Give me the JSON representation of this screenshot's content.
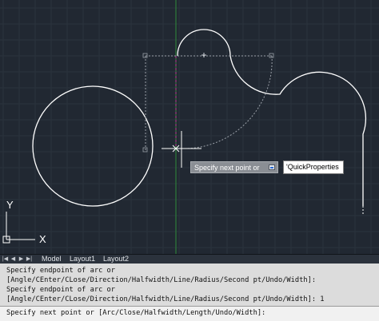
{
  "colors": {
    "background": "#212832",
    "grid": "#2b333d",
    "geometry": "#ffffff",
    "axis_x": "#b33c8e",
    "axis_y": "#2e8b3a",
    "tracking": "#9aa0a8"
  },
  "icons": {
    "ucs": "ucs-icon",
    "crosshair": "crosshair-cursor-icon",
    "dynamic_input": "dynamic-input-icon",
    "tab_first": "first-tab-icon",
    "tab_prev": "previous-tab-icon",
    "tab_next": "next-tab-icon",
    "tab_last": "last-tab-icon"
  },
  "ucs": {
    "x_label": "X",
    "y_label": "Y"
  },
  "tooltip": {
    "prompt": "Specify next point or",
    "input_value": "'QuickProperties"
  },
  "tabs": {
    "nav_first": "|◀",
    "nav_prev": "◀",
    "nav_next": "▶",
    "nav_last": "▶|",
    "model": "Model",
    "layout1": "Layout1",
    "layout2": "Layout2"
  },
  "command_line": {
    "history": [
      "Specify endpoint of arc or",
      "[Angle/CEnter/CLose/Direction/Halfwidth/Line/Radius/Second pt/Undo/Width]:",
      "Specify endpoint of arc or",
      "[Angle/CEnter/CLose/Direction/Halfwidth/Line/Radius/Second pt/Undo/Width]: 1"
    ],
    "prompt": "Specify next point or [Arc/Close/Halfwidth/Length/Undo/Width]:"
  }
}
